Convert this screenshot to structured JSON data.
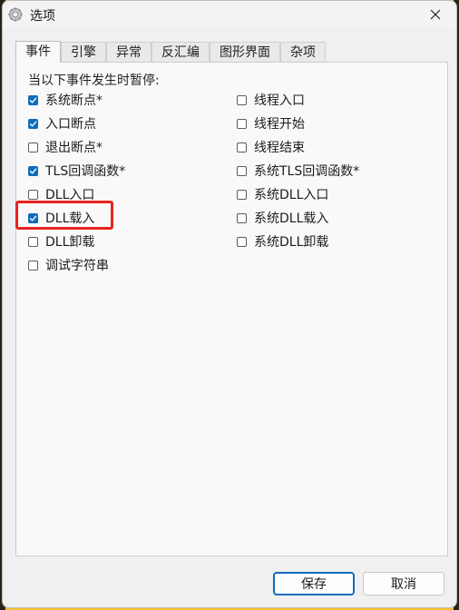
{
  "window": {
    "title": "选项"
  },
  "tabs": [
    {
      "label": "事件",
      "active": true
    },
    {
      "label": "引擎",
      "active": false
    },
    {
      "label": "异常",
      "active": false
    },
    {
      "label": "反汇编",
      "active": false
    },
    {
      "label": "图形界面",
      "active": false
    },
    {
      "label": "杂项",
      "active": false
    }
  ],
  "events": {
    "heading": "当以下事件发生时暂停:",
    "left": [
      {
        "label": "系统断点*",
        "checked": true
      },
      {
        "label": "入口断点",
        "checked": true
      },
      {
        "label": "退出断点*",
        "checked": false
      },
      {
        "label": "TLS回调函数*",
        "checked": true
      },
      {
        "label": "DLL入口",
        "checked": false
      },
      {
        "label": "DLL载入",
        "checked": true
      },
      {
        "label": "DLL卸载",
        "checked": false
      },
      {
        "label": "调试字符串",
        "checked": false
      }
    ],
    "right": [
      {
        "label": "线程入口",
        "checked": false
      },
      {
        "label": "线程开始",
        "checked": false
      },
      {
        "label": "线程结束",
        "checked": false
      },
      {
        "label": "系统TLS回调函数*",
        "checked": false
      },
      {
        "label": "系统DLL入口",
        "checked": false
      },
      {
        "label": "系统DLL载入",
        "checked": false
      },
      {
        "label": "系统DLL卸载",
        "checked": false
      }
    ]
  },
  "buttons": {
    "save": "保存",
    "cancel": "取消"
  },
  "colors": {
    "accent": "#0f6cbd",
    "highlight": "#e8231f"
  },
  "icons": {
    "app": "gear-icon",
    "close": "close-icon",
    "check": "checkmark-icon"
  }
}
